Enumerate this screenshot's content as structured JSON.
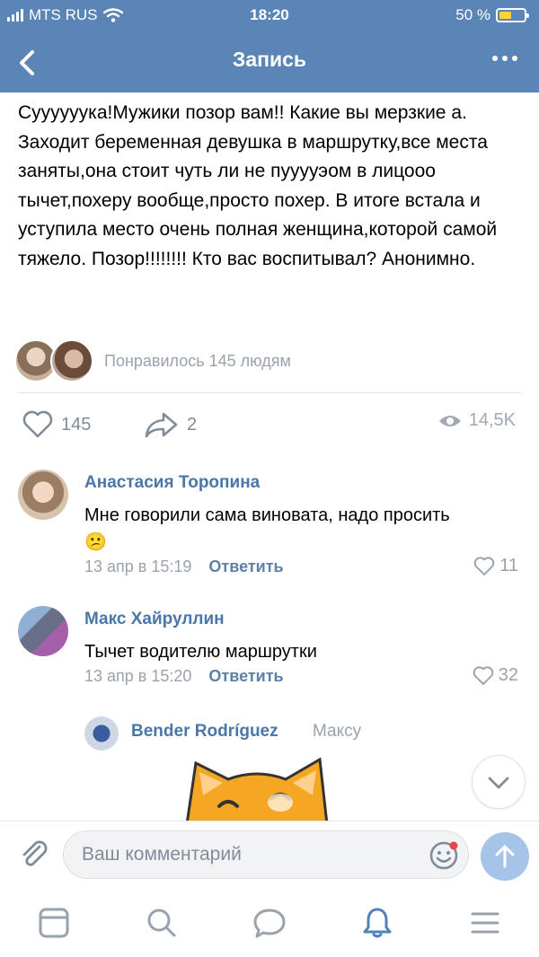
{
  "status_bar": {
    "carrier": "MTS RUS",
    "time": "18:20",
    "battery": "50 %",
    "battery_level": 0.5
  },
  "nav": {
    "title": "Запись"
  },
  "post": {
    "text": "Суууууука!Мужики позор вам!! Какие вы мерзкие а. Заходит беременная девушка в маршрутку,все места заняты,она стоит чуть ли не пууууэом в лицооо тычет,похеру вообще,просто похер. В итоге встала и уступила место очень полная женщина,которой самой тяжело. Позор!!!!!!!! Кто вас воспитывал? Анонимно.",
    "liked_by": "Понравилось 145 людям",
    "likes": "145",
    "shares": "2",
    "views": "14,5K"
  },
  "comments": [
    {
      "author": "Анастасия Торопина",
      "text": "Мне говорили сама виновата, надо просить",
      "emoji": "😕",
      "time": "13 апр в 15:19",
      "reply": "Ответить",
      "likes": "11"
    },
    {
      "author": "Макс Хайруллин",
      "text": "Тычет водителю маршрутки",
      "time": "13 апр в 15:20",
      "reply": "Ответить",
      "likes": "32"
    }
  ],
  "reply": {
    "author": "Bender Rodríguez",
    "to": "Максу"
  },
  "composer": {
    "placeholder": "Ваш комментарий"
  },
  "colors": {
    "header": "#5b85b6",
    "link": "#4a76a8",
    "accent": "#5181b8",
    "muted": "#99a2ad"
  },
  "tabs": [
    "news-icon",
    "search-icon",
    "messages-icon",
    "notifications-icon",
    "menu-icon"
  ]
}
